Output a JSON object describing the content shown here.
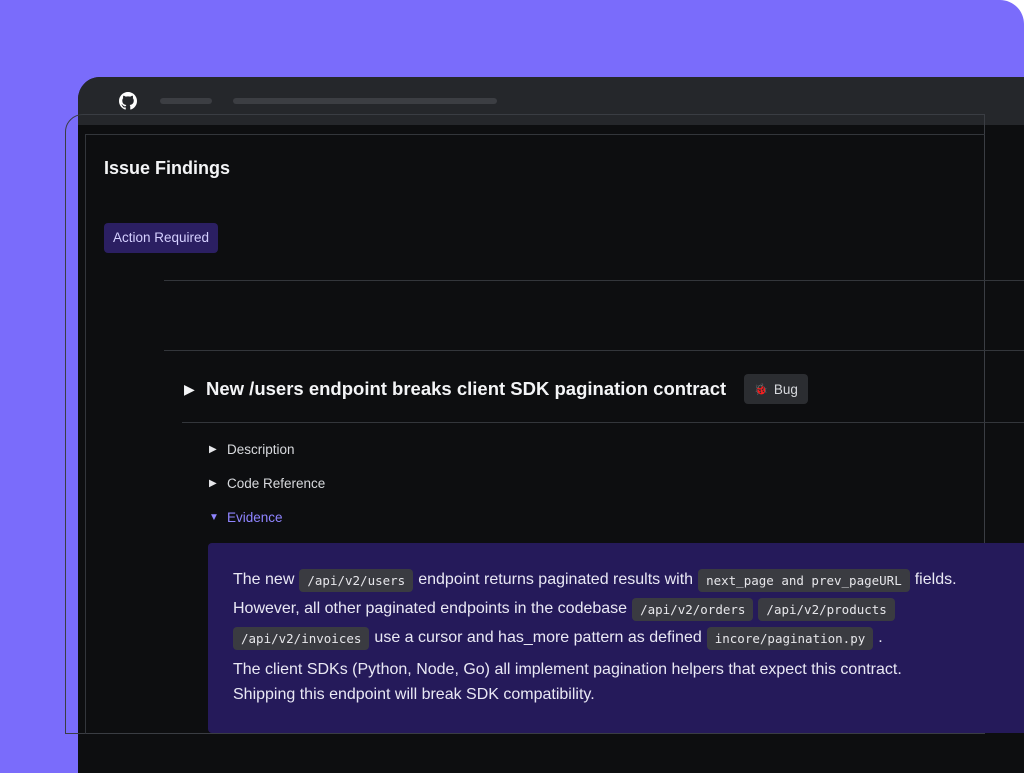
{
  "panel": {
    "title": "Issue Findings",
    "status_badge": "Action Required"
  },
  "finding": {
    "title": "New /users endpoint breaks client SDK pagination contract",
    "tag_label": "Bug",
    "tag_icon": "bug-icon"
  },
  "sections": {
    "description": "Description",
    "code_reference": "Code Reference",
    "evidence": "Evidence"
  },
  "evidence": {
    "l1_a": "The new",
    "l1_code_a": "/api/v2/users",
    "l1_b": "endpoint returns paginated results with",
    "l1_code_b": "next_page and prev_pageURL",
    "l1_c": "fields.",
    "l2_a": "However, all other paginated endpoints in the codebase",
    "l2_code_a": "/api/v2/orders",
    "l2_code_b": "/api/v2/products",
    "l3_code_a": "/api/v2/invoices",
    "l3_a": "use a cursor and has_more pattern as defined",
    "l3_code_b": "incore/pagination.py",
    "l3_b": ".",
    "l4": "The client SDKs (Python, Node, Go) all implement pagination helpers that expect this contract.",
    "l5": "Shipping this endpoint will break SDK compatibility."
  },
  "colors": {
    "background": "#7a6cfb",
    "window": "#0d0e10",
    "accent": "#8f84ff",
    "badge": "#2b1f62",
    "evidence_box": "#251a5a"
  }
}
